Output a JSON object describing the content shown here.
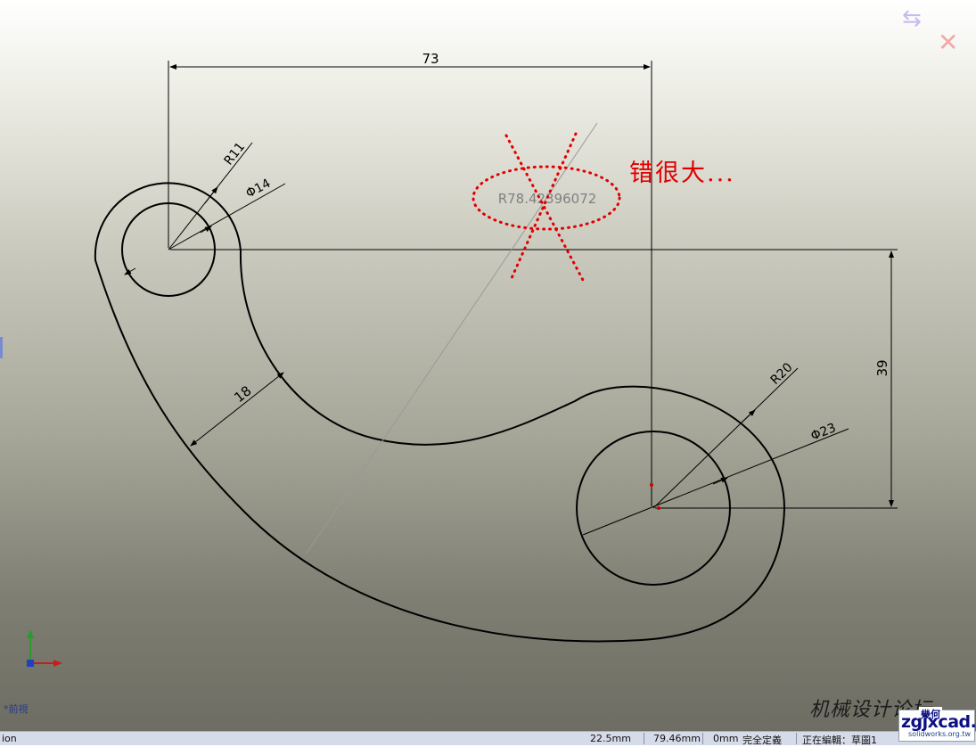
{
  "drawing": {
    "dim_horizontal": "73",
    "dim_vertical": "39",
    "dim_r_small": "R11",
    "dim_d_small": "Φ14",
    "dim_width": "18",
    "dim_r_large": "R20",
    "dim_d_large": "Φ23",
    "dim_r_arc": "R78.42396072"
  },
  "annotation": {
    "text": "错很大...",
    "color": "#e00000"
  },
  "view": {
    "label": "*前視"
  },
  "left_edge_text": "ion",
  "status_bar": {
    "x_value": "22.5mm",
    "y_value": "79.46mm",
    "z_value": "0mm",
    "definition_state": "完全定義",
    "editing": "正在編輯：草圖1"
  },
  "watermark": {
    "text": "机械设计论坛",
    "url_text": "zgjxcad.com"
  },
  "logo": {
    "badge": "幾何",
    "main": "SolidWorks",
    "sub": "solidworks.org.tw"
  },
  "icons": {
    "confirm": "confirm-corner-icon",
    "close": "close-corner-icon"
  },
  "colors": {
    "sketch_line": "#000000",
    "annotation_red": "#e00000"
  }
}
